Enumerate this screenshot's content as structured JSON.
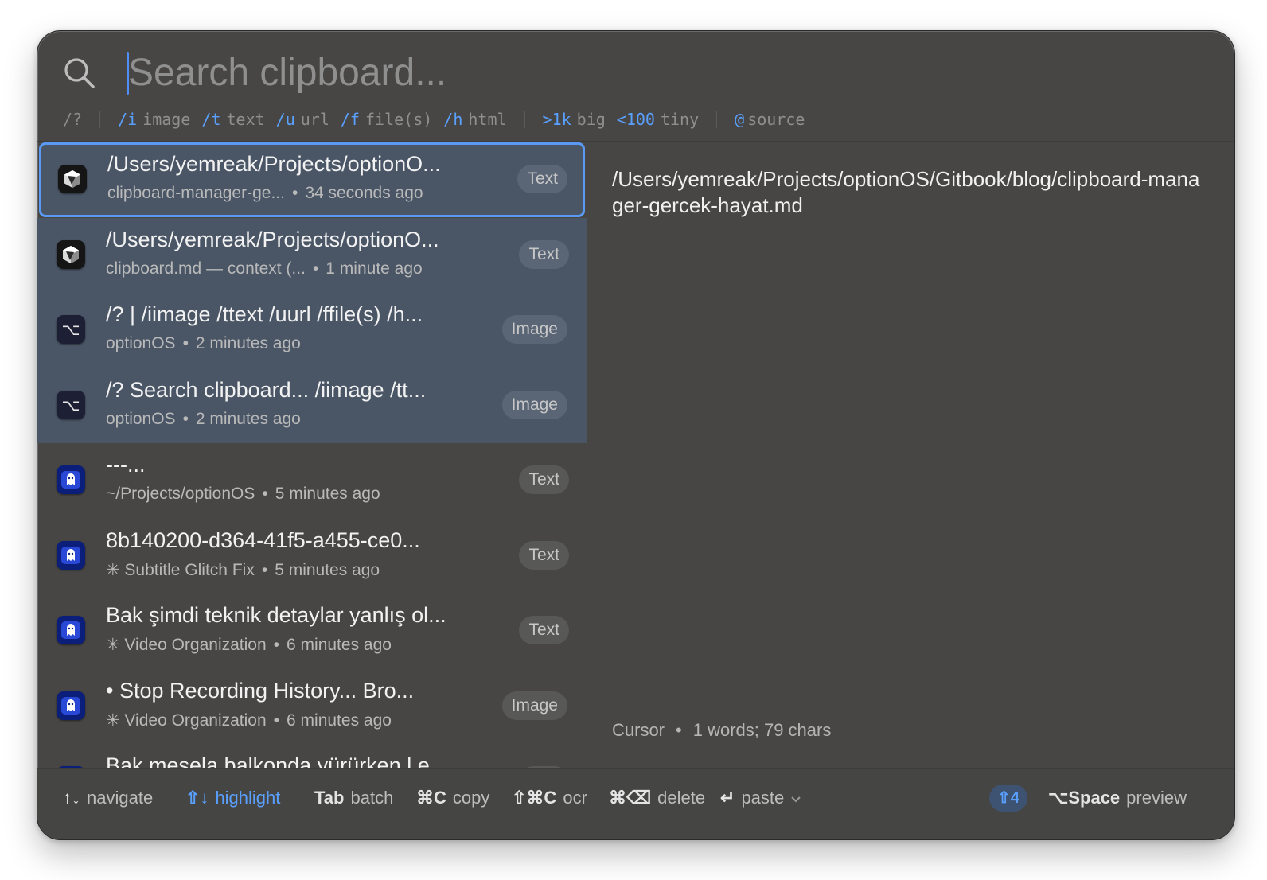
{
  "search": {
    "placeholder": "Search clipboard..."
  },
  "hints": {
    "help": "/?",
    "filters": [
      {
        "key": "/i",
        "label": "image"
      },
      {
        "key": "/t",
        "label": "text"
      },
      {
        "key": "/u",
        "label": "url"
      },
      {
        "key": "/f",
        "label": "file(s)"
      },
      {
        "key": "/h",
        "label": "html"
      }
    ],
    "size_filters": [
      {
        "key": ">1k",
        "label": "big"
      },
      {
        "key": "<100",
        "label": "tiny"
      }
    ],
    "source": {
      "key": "@",
      "label": "source"
    }
  },
  "items": [
    {
      "title": "/Users/yemreak/Projects/optionO...",
      "source": "clipboard-manager-ge...",
      "time": "34 seconds ago",
      "type": "Text",
      "icon": "cursor-app-icon",
      "state": "active"
    },
    {
      "title": "/Users/yemreak/Projects/optionO...",
      "source": "clipboard.md — context (...",
      "time": "1 minute ago",
      "type": "Text",
      "icon": "cursor-app-icon",
      "state": "selected"
    },
    {
      "title": "/? | /iimage /ttext /uurl /ffile(s) /h...",
      "source": "optionOS",
      "time": "2 minutes ago",
      "type": "Image",
      "icon": "option-app-icon",
      "state": "selected"
    },
    {
      "title": "/? Search clipboard... /iimage /tt...",
      "source": "optionOS",
      "time": "2 minutes ago",
      "type": "Image",
      "icon": "option-app-icon",
      "state": "selected"
    },
    {
      "title": "---...",
      "source": "~/Projects/optionOS",
      "time": "5 minutes ago",
      "type": "Text",
      "icon": "ghost-app-icon",
      "state": "normal"
    },
    {
      "title": "8b140200-d364-41f5-a455-ce0...",
      "source": "✳ Subtitle Glitch Fix",
      "time": "5 minutes ago",
      "type": "Text",
      "icon": "ghost-app-icon",
      "state": "normal"
    },
    {
      "title": "Bak şimdi teknik detaylar yanlış ol...",
      "source": "✳ Video Organization",
      "time": "6 minutes ago",
      "type": "Text",
      "icon": "ghost-app-icon",
      "state": "normal"
    },
    {
      "title": "• Stop Recording History... Bro...",
      "source": "✳ Video Organization",
      "time": "6 minutes ago",
      "type": "Image",
      "icon": "ghost-app-icon",
      "state": "normal"
    },
    {
      "title": "Bak mesela balkonda yürürken l e...",
      "source": "",
      "time": "",
      "type": "Text",
      "icon": "ghost-app-icon",
      "state": "normal"
    }
  ],
  "preview": {
    "text": "/Users/yemreak/Projects/optionOS/Gitbook/blog/clipboard-manager-gercek-hayat.md",
    "app": "Cursor",
    "stats": "1 words; 79 chars"
  },
  "footer": {
    "navigate": {
      "key": "↑↓",
      "label": "navigate"
    },
    "highlight": {
      "key": "⇧↓",
      "label": "highlight"
    },
    "batch": {
      "key": "Tab",
      "label": "batch"
    },
    "copy": {
      "key": "⌘C",
      "label": "copy"
    },
    "ocr": {
      "key": "⇧⌘C",
      "label": "ocr"
    },
    "delete": {
      "key": "⌘⌫",
      "label": "delete"
    },
    "paste": {
      "key": "↵",
      "label": "paste"
    },
    "selected_count": "⇧4",
    "preview": {
      "key": "⌥Space",
      "label": "preview"
    }
  },
  "colors": {
    "accent": "#5aa0ff",
    "selection": "#4a5666",
    "window": "#474645"
  }
}
